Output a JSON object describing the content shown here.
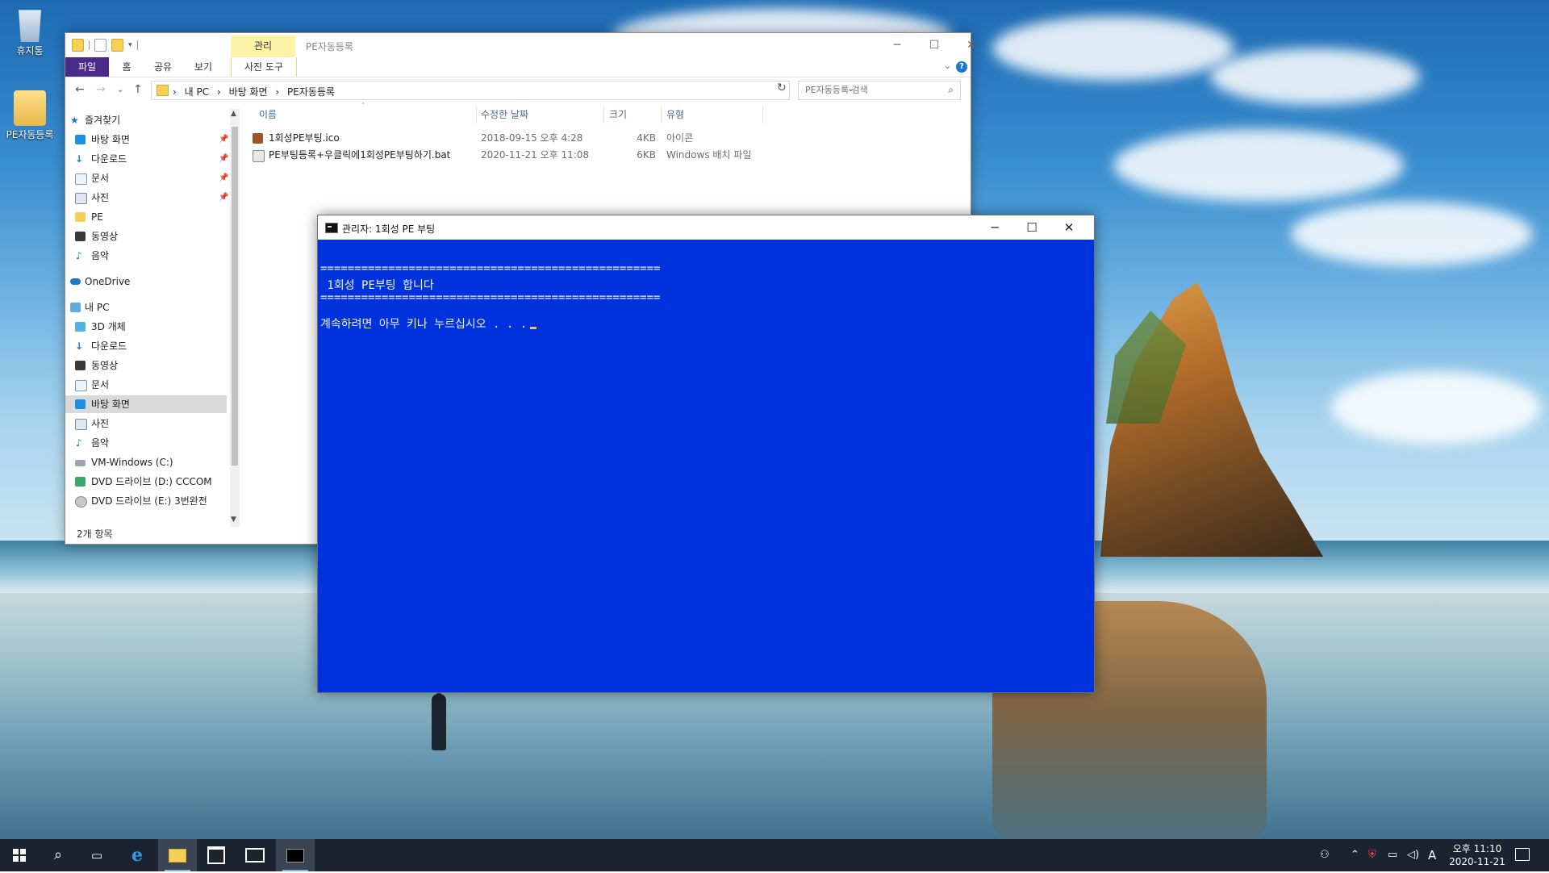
{
  "desktop": {
    "icons": [
      {
        "label": "휴지통",
        "icon": "recycle-bin-icon"
      },
      {
        "label": "PE자동등록",
        "icon": "folder-icon"
      }
    ]
  },
  "explorer": {
    "title": "PE자동등록",
    "context_tab_header": "관리",
    "tabs": {
      "file": "파일",
      "home": "홈",
      "share": "공유",
      "view": "보기",
      "picture_tools": "사진 도구"
    },
    "address": {
      "crumbs": [
        "내 PC",
        "바탕 화면",
        "PE자동등록"
      ],
      "separator": "›"
    },
    "search_placeholder": "PE자동등록 검색",
    "columns": {
      "name": "이름",
      "modified": "수정한 날짜",
      "size": "크기",
      "type": "유형"
    },
    "files": [
      {
        "name": "1회성PE부팅.ico",
        "modified": "2018-09-15 오후 4:28",
        "size": "4KB",
        "type": "아이콘",
        "icon": "image-file-icon"
      },
      {
        "name": "PE부팅등록+우클릭에1회성PE부팅하기.bat",
        "modified": "2020-11-21 오후 11:08",
        "size": "6KB",
        "type": "Windows 배치 파일",
        "icon": "batch-file-icon"
      }
    ],
    "nav": {
      "quick_access": "즐겨찾기",
      "quick_items": [
        "바탕 화면",
        "다운로드",
        "문서",
        "사진",
        "PE",
        "동영상",
        "음악"
      ],
      "onedrive": "OneDrive",
      "this_pc": "내 PC",
      "pc_items": [
        "3D 개체",
        "다운로드",
        "동영상",
        "문서",
        "바탕 화면",
        "사진",
        "음악",
        "VM-Windows (C:)",
        "DVD 드라이브 (D:) CCCOM",
        "DVD 드라이브 (E:) 3번완전"
      ]
    },
    "status": "2개 항목"
  },
  "cmd": {
    "title": "관리자:  1회성 PE 부팅",
    "lines": {
      "rule": "==================================================",
      "message": " 1회성 PE부팅 합니다",
      "prompt": "계속하려면 아무 키나 누르십시오 . . ."
    }
  },
  "taskbar": {
    "clock_time": "오후 11:10",
    "clock_date": "2020-11-21",
    "ime": "A"
  },
  "colors": {
    "cmd_background": "#0033dd",
    "file_tab": "#4a2a8a",
    "context_tab": "#fdf3a7",
    "taskbar": "#1b2330"
  }
}
